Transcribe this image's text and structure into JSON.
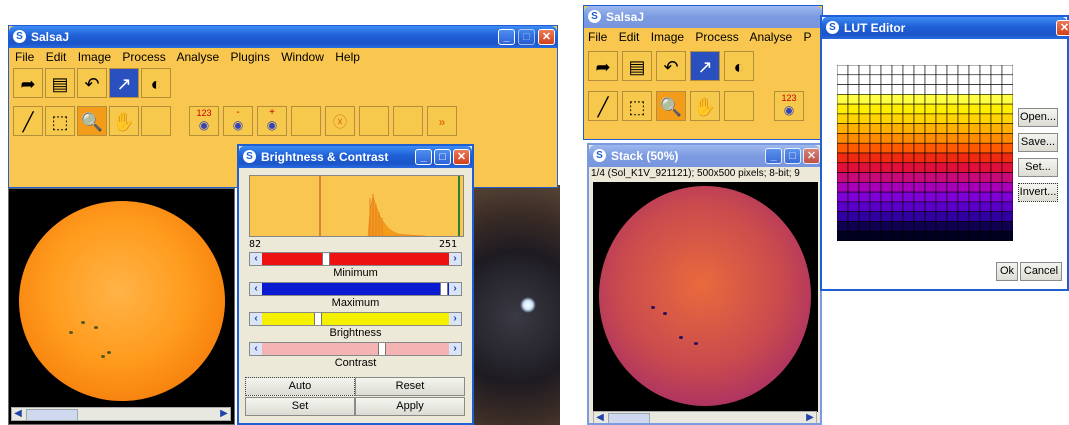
{
  "left_app": {
    "title": "SalsaJ",
    "menu": [
      "File",
      "Edit",
      "Image",
      "Process",
      "Analyse",
      "Plugins",
      "Window",
      "Help"
    ],
    "counter_icon_label": "123",
    "minus_icon_label": "-",
    "plus_icon_label": "+",
    "more_icon_label": "»"
  },
  "bc_dialog": {
    "title": "Brightness & Contrast",
    "hist_min": "82",
    "hist_max": "251",
    "labels": [
      "Minimum",
      "Maximum",
      "Brightness",
      "Contrast"
    ],
    "buttons": [
      "Auto",
      "Reset",
      "Set",
      "Apply"
    ],
    "slider_colors": [
      "#ee1111",
      "#0a1ad0",
      "#f5f000",
      "#f4b4b4"
    ]
  },
  "right_app": {
    "title": "SalsaJ",
    "menu": [
      "File",
      "Edit",
      "Image",
      "Process",
      "Analyse",
      "P"
    ],
    "counter_icon_label": "123"
  },
  "stack_window": {
    "title": "Stack (50%)",
    "info": "1/4 (Sol_K1V_921121); 500x500 pixels; 8-bit; 9"
  },
  "lut_editor": {
    "title": "LUT Editor",
    "buttons": [
      "Open...",
      "Save...",
      "Set...",
      "Invert..."
    ],
    "ok": "Ok",
    "cancel": "Cancel"
  },
  "colors": {
    "toolbar_bg": "#f9c74f",
    "accent_blue": "#1f5fd6"
  }
}
